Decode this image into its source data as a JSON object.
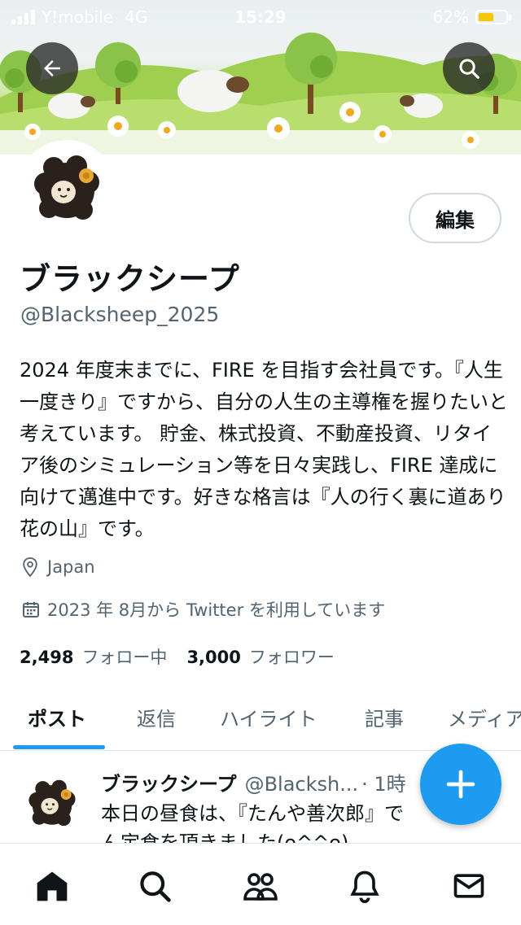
{
  "status_bar": {
    "carrier": "Y!mobile",
    "network": "4G",
    "time": "15:29",
    "battery": "62%",
    "battery_level": 0.62
  },
  "header": {
    "back_icon": "arrow-left-icon",
    "search_icon": "search-icon"
  },
  "profile": {
    "edit_label": "編集",
    "display_name": "ブラックシープ",
    "handle": "@Blacksheep_2025",
    "bio": "2024 年度末までに、FIRE を目指す会社員です。『人生一度きり』ですから、自分の人生の主導権を握りたいと考えています。 貯金、株式投資、不動産投資、リタイア後のシミュレーション等を日々実践し、FIRE 達成に向けて邁進中です。好きな格言は『人の行く裏に道あり花の山』です。",
    "location": "Japan",
    "joined": "2023 年 8月から Twitter を利用しています",
    "following_count": "2,498",
    "following_label": "フォロー中",
    "followers_count": "3,000",
    "followers_label": "フォロワー"
  },
  "tabs": [
    {
      "label": "ポスト",
      "active": true
    },
    {
      "label": "返信",
      "active": false
    },
    {
      "label": "ハイライト",
      "active": false
    },
    {
      "label": "記事",
      "active": false
    },
    {
      "label": "メディア",
      "active": false
    }
  ],
  "tweet": {
    "name": "ブラックシープ",
    "handle": "@Blacksh...",
    "time": "· 1時",
    "text": "本日の昼食は、『たんや善次郎』で\nん定食を頂きました(o^^o)"
  },
  "fab": {
    "icon": "plus-icon"
  },
  "bottom_nav": [
    {
      "icon": "home-icon",
      "active": true
    },
    {
      "icon": "search-icon",
      "active": false
    },
    {
      "icon": "communities-icon",
      "active": false
    },
    {
      "icon": "bell-icon",
      "active": false
    },
    {
      "icon": "mail-icon",
      "active": false
    }
  ],
  "colors": {
    "accent": "#1d9bf0",
    "text": "#0f1419",
    "secondary": "#536471"
  }
}
